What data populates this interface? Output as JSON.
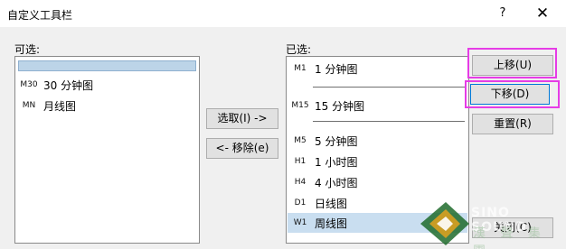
{
  "window": {
    "title": "自定义工具栏",
    "help_label": "?",
    "close_label": "✕"
  },
  "left": {
    "header": "可选:",
    "items": [
      {
        "code": "",
        "label": ""
      },
      {
        "code": "M30",
        "label": "30 分钟图"
      },
      {
        "code": "MN",
        "label": "月线图"
      }
    ]
  },
  "middle": {
    "select_label": "选取(I) ->",
    "remove_label": "<- 移除(e)"
  },
  "right": {
    "header": "已选:",
    "items": [
      {
        "code": "M1",
        "label": "1 分钟图"
      },
      {
        "code": "M15",
        "label": "15 分钟图"
      },
      {
        "code": "M5",
        "label": "5 分钟图"
      },
      {
        "code": "H1",
        "label": "1 小时图"
      },
      {
        "code": "H4",
        "label": "4 小时图"
      },
      {
        "code": "D1",
        "label": "日线图"
      },
      {
        "code": "W1",
        "label": "周线图"
      }
    ]
  },
  "buttons": {
    "up": "上移(U)",
    "down": "下移(D)",
    "reset": "重置(R)",
    "close": "关闭(C)"
  },
  "watermark": {
    "text": "SINO SOUND",
    "chars": "漢 聲 集 團"
  },
  "colors": {
    "highlight": "#e63ce6",
    "selection": "#c9def0",
    "focus": "#0078d7"
  }
}
